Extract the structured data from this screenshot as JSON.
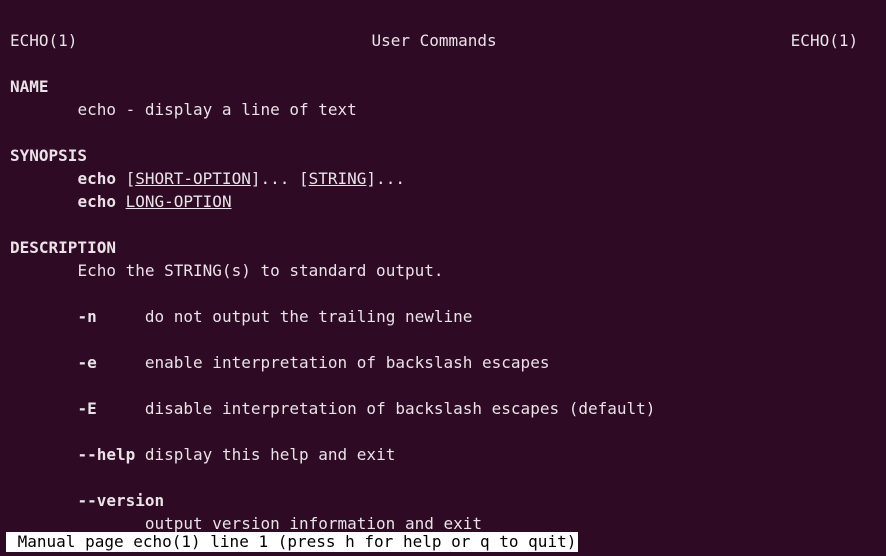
{
  "header": {
    "left": "ECHO(1)",
    "center": "User Commands",
    "right": "ECHO(1)"
  },
  "sections": {
    "name": {
      "heading": "NAME",
      "line": "echo - display a line of text"
    },
    "synopsis": {
      "heading": "SYNOPSIS",
      "cmd1": "echo",
      "cmd1_mid": " [",
      "cmd1_arg1": "SHORT-OPTION",
      "cmd1_mid2": "]... [",
      "cmd1_arg2": "STRING",
      "cmd1_tail": "]...",
      "cmd2": "echo",
      "cmd2_sp": " ",
      "cmd2_arg": "LONG-OPTION"
    },
    "description": {
      "heading": "DESCRIPTION",
      "intro": "Echo the STRING(s) to standard output.",
      "options": [
        {
          "flag": "-n",
          "desc": "do not output the trailing newline",
          "pad": "     "
        },
        {
          "flag": "-e",
          "desc": "enable interpretation of backslash escapes",
          "pad": "     "
        },
        {
          "flag": "-E",
          "desc": "disable interpretation of backslash escapes (default)",
          "pad": "     "
        },
        {
          "flag": "--help",
          "desc": "display this help and exit",
          "pad": " "
        },
        {
          "flag": "--version",
          "desc": "output version information and exit",
          "pad": "",
          "newline": true
        }
      ]
    }
  },
  "status": " Manual page echo(1) line 1 (press h for help or q to quit)",
  "indent": {
    "sec": "       ",
    "opt": "       ",
    "desc": "              "
  }
}
